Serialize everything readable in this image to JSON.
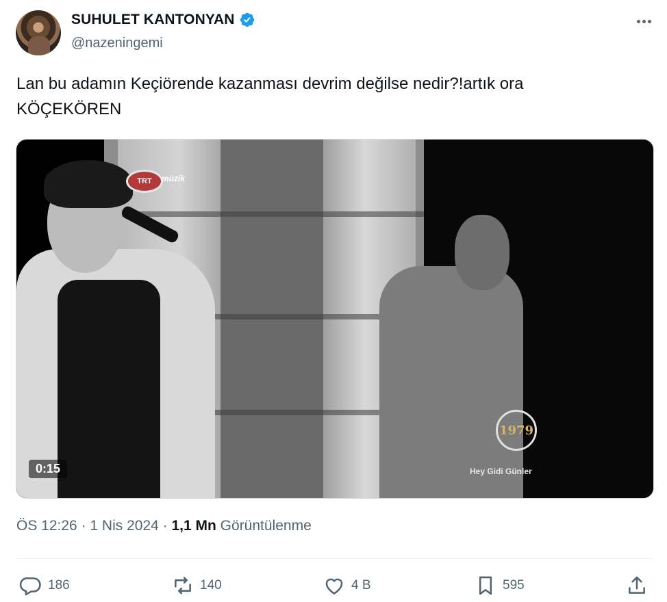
{
  "author": {
    "display_name": "SUHULET KANTONYAN",
    "handle": "@nazeningemi",
    "verified": true,
    "verified_color": "#1d9bf0"
  },
  "tweet": {
    "text": "Lan bu adamın Keçiörende kazanması devrim değilse nedir?!artık ora\nKÖÇEKÖREN"
  },
  "video": {
    "duration": "0:15",
    "overlay_logo_text": "TRT",
    "overlay_channel_text": "müzik",
    "overlay_year": "1979",
    "overlay_caption": "Hey Gidi Günler"
  },
  "meta": {
    "time": "ÖS 12:26",
    "separator": " · ",
    "date": "1 Nis 2024",
    "views_count": "1,1 Mn",
    "views_label": " Görüntülenme"
  },
  "actions": {
    "replies": "186",
    "retweets": "140",
    "likes": "4 B",
    "bookmarks": "595"
  },
  "colors": {
    "text_primary": "#0f1419",
    "text_secondary": "#536471",
    "divider": "#eff3f4"
  },
  "icons": [
    "more-icon",
    "verified-badge-icon",
    "reply-icon",
    "retweet-icon",
    "like-icon",
    "bookmark-icon",
    "share-icon"
  ]
}
